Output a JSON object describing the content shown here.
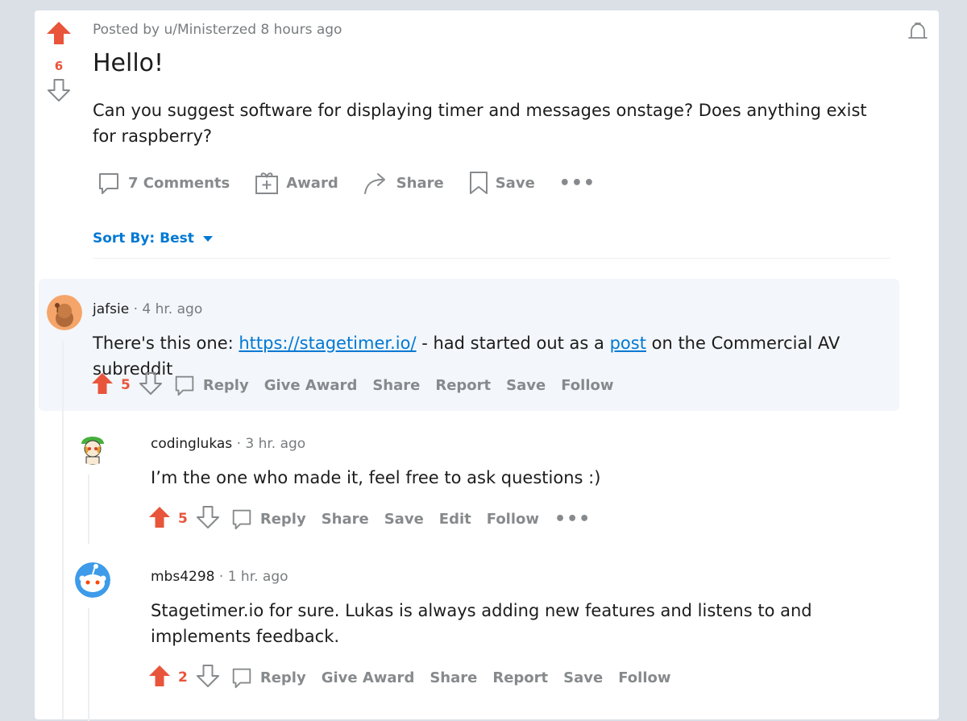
{
  "post": {
    "vote_count": "6",
    "meta": "Posted by u/Ministerzed 8 hours ago",
    "title": "Hello!",
    "body": "Can you suggest software for displaying timer and messages onstage? Does anything exist for raspberry?",
    "actions": {
      "comments": "7 Comments",
      "award": "Award",
      "share": "Share",
      "save": "Save",
      "more": "•••"
    },
    "sort_label": "Sort By: Best"
  },
  "comments": [
    {
      "user": "jafsie",
      "time": "· 4 hr. ago",
      "text_before": "There's this one: ",
      "link1": "https://stagetimer.io/",
      "text_middle": " - had started out as a ",
      "link2": "post",
      "text_after": " on the Commercial AV subreddit",
      "votes": "5",
      "actions": [
        "Reply",
        "Give Award",
        "Share",
        "Report",
        "Save",
        "Follow"
      ]
    },
    {
      "user": "codinglukas",
      "time": "· 3 hr. ago",
      "text": "I’m the one who made it, feel free to ask questions :)",
      "votes": "5",
      "actions": [
        "Reply",
        "Share",
        "Save",
        "Edit",
        "Follow"
      ],
      "more": "•••"
    },
    {
      "user": "mbs4298",
      "time": "· 1 hr. ago",
      "text": "Stagetimer.io for sure. Lukas is always adding new features and listens to and implements feedback.",
      "votes": "2",
      "actions": [
        "Reply",
        "Give Award",
        "Share",
        "Report",
        "Save",
        "Follow"
      ]
    }
  ],
  "colors": {
    "upvote": "#e8553b",
    "link": "#0079d3",
    "muted": "#878a8c",
    "background": "#dae0e6"
  }
}
